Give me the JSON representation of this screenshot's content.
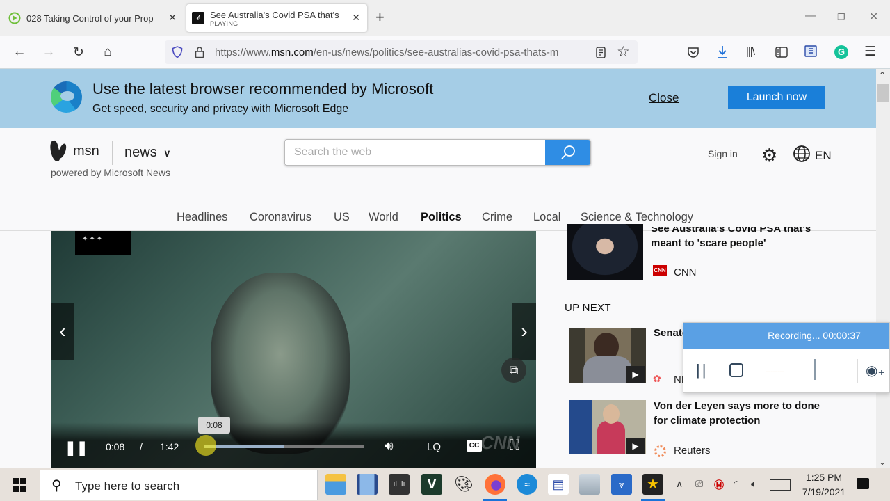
{
  "browser": {
    "tabs": [
      {
        "title": "028 Taking Control of your Prop",
        "subtitle": "",
        "icon": "play-circle-icon",
        "active": false
      },
      {
        "title": "See Australia's Covid PSA that's",
        "subtitle": "PLAYING",
        "icon": "msn-icon",
        "active": true
      }
    ],
    "new_tab_label": "+",
    "window_controls": {
      "minimize": "—",
      "restore": "❐",
      "close": "✕"
    },
    "nav": {
      "back": "←",
      "forward": "→",
      "reload": "↻",
      "home": "⌂"
    },
    "url": {
      "prefix": "https://www.",
      "domain": "msn.com",
      "path": "/en-us/news/politics/see-australias-covid-psa-thats-m"
    },
    "toolbar_icons": [
      "pocket-icon",
      "download-icon",
      "library-icon",
      "sidebar-icon",
      "notes-extension-icon",
      "grammarly-icon",
      "menu-icon"
    ]
  },
  "banner": {
    "title": "Use the latest browser recommended by Microsoft",
    "subtitle": "Get speed, security and privacy with Microsoft Edge",
    "close_label": "Close",
    "launch_label": "Launch now"
  },
  "header": {
    "logo_text": "msn",
    "section": "news",
    "section_chevron": "⌄",
    "powered_by": "powered by Microsoft News",
    "search_placeholder": "Search the web",
    "search_value": "",
    "sign_in": "Sign in",
    "language": "EN"
  },
  "categories": [
    {
      "label": "Headlines",
      "active": false
    },
    {
      "label": "Coronavirus",
      "active": false
    },
    {
      "label": "US",
      "active": false
    },
    {
      "label": "World",
      "active": false
    },
    {
      "label": "Politics",
      "active": true
    },
    {
      "label": "Crime",
      "active": false
    },
    {
      "label": "Local",
      "active": false
    },
    {
      "label": "Science & Technology",
      "active": false
    }
  ],
  "video": {
    "current_time": "0:08",
    "separator": "/",
    "duration": "1:42",
    "tooltip_time": "0:08",
    "played_fraction": 0.08,
    "buffered_fraction": 0.5,
    "quality": "LQ",
    "cc": "CC",
    "watermark": "CNN",
    "channel_logo": "✦✦✦"
  },
  "rail": {
    "current": {
      "title": "See Australia's Covid PSA that's meant to 'scare people'",
      "source": "CNN",
      "source_icon": "CNN"
    },
    "up_next_label": "UP NEXT",
    "items": [
      {
        "title": "Senator Warnock: Georgia ...",
        "title_visible": "Senat\nGeorg",
        "source": "NBC News",
        "source_visible": "N"
      },
      {
        "title": "Von der Leyen says more to done for climate protection",
        "source": "Reuters"
      }
    ]
  },
  "recorder": {
    "status": "Recording... 00:00:37",
    "audio_level": "----‐-‐-"
  },
  "taskbar": {
    "search_placeholder": "Type here to search",
    "apps": [
      "file-explorer-icon",
      "video-editor-icon",
      "audio-editor-icon",
      "v-app-icon",
      "paint-icon",
      "firefox-icon",
      "openoffice-icon",
      "notes-icon",
      "scanner-icon",
      "downloader-icon",
      "movie-maker-icon"
    ],
    "time": "1:25 PM",
    "date": "7/19/2021"
  }
}
